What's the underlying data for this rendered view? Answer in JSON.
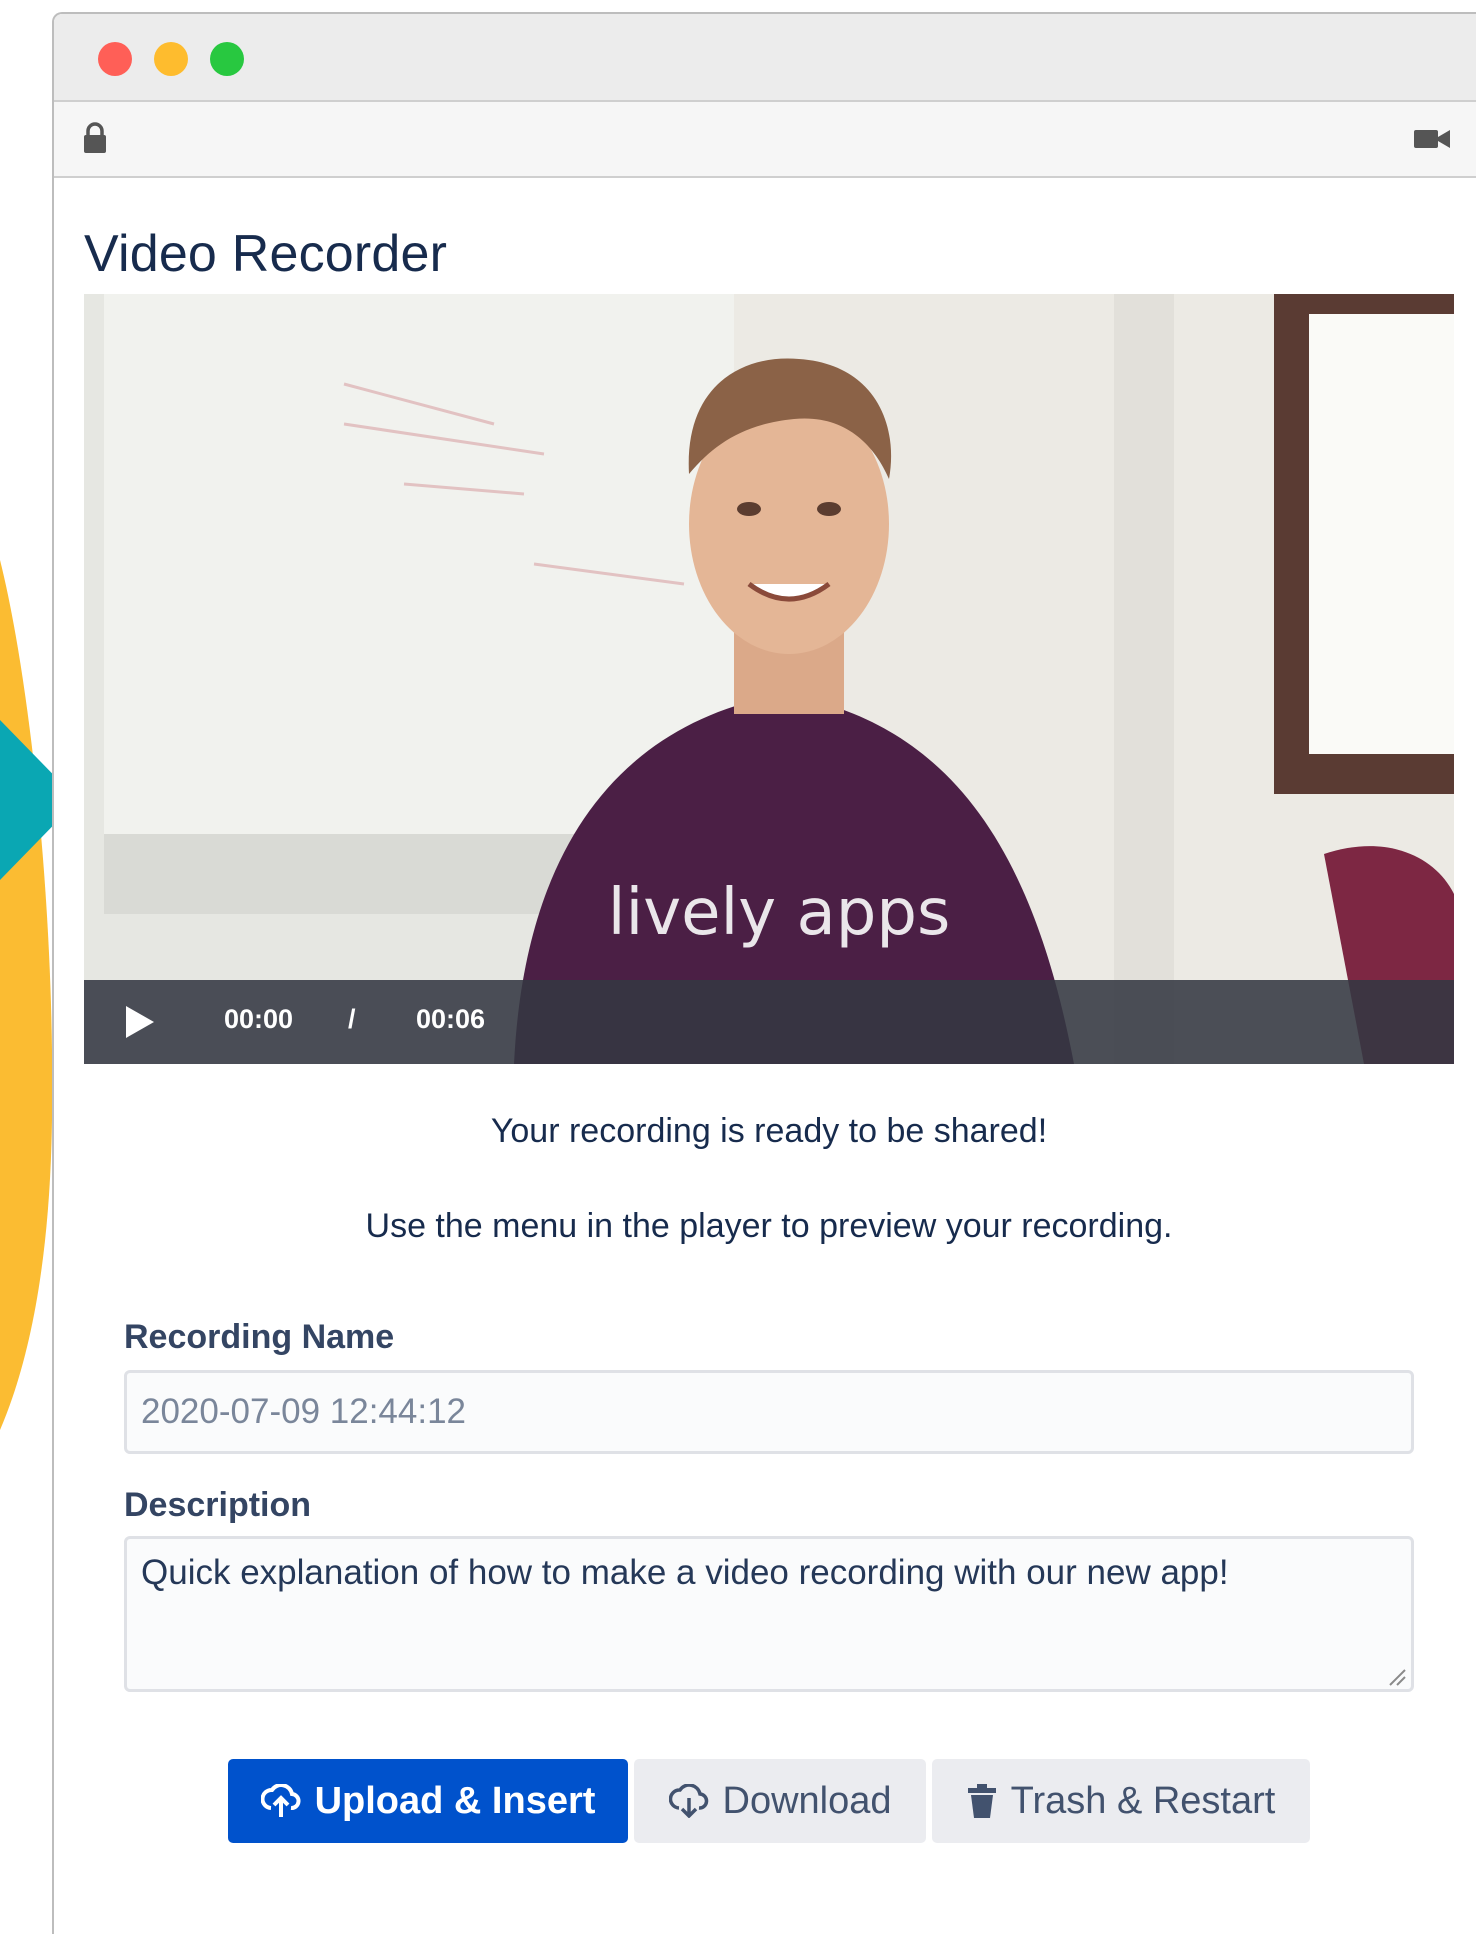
{
  "page": {
    "title": "Video Recorder"
  },
  "window": {
    "traffic_lights": [
      "#ff5f57",
      "#febc2e",
      "#28c840"
    ],
    "lock_icon": "lock-icon",
    "camera_icon": "video-camera-icon"
  },
  "player": {
    "current_time": "00:00",
    "separator": "/",
    "duration": "00:06",
    "shirt_text": "lively apps",
    "play_icon": "play-icon"
  },
  "messages": {
    "ready": "Your recording is ready to be shared!",
    "hint": "Use the menu in the player to preview your recording."
  },
  "form": {
    "name_label": "Recording Name",
    "name_value": "2020-07-09 12:44:12",
    "description_label": "Description",
    "description_value": "Quick explanation of how to make a video recording with our new app!"
  },
  "buttons": {
    "upload": "Upload & Insert",
    "download": "Download",
    "trash": "Trash & Restart"
  },
  "colors": {
    "primary": "#0052cc",
    "secondary_bg": "#ebecf0",
    "title": "#172b4d",
    "deco_yellow": "#fbbc32",
    "deco_teal": "#0aa7b3",
    "deco_magenta": "#c8196d"
  }
}
